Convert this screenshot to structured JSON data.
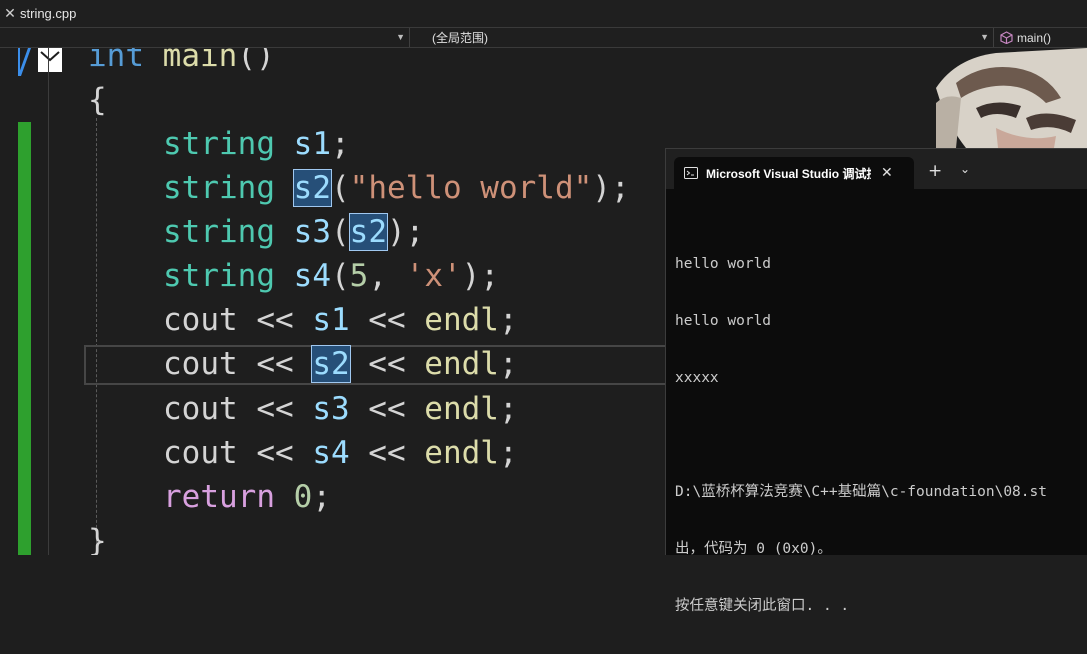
{
  "tab": {
    "close_glyph": "✕",
    "file_name": "string.cpp"
  },
  "navbar": {
    "project_combo": "",
    "scope_combo": "(全局范围)",
    "member_combo": "main()",
    "member_icon": "cube-icon"
  },
  "editor": {
    "signature": {
      "kw": "int",
      "name": "main",
      "parens": "()"
    },
    "open_brace": "{",
    "close_brace": "}",
    "lines": {
      "l1": {
        "type": "string",
        "name": "s1",
        "end": ";"
      },
      "l2": {
        "type": "string",
        "name": "s2",
        "open": "(",
        "arg": "\"hello world\"",
        "close": ");"
      },
      "l3": {
        "type": "string",
        "name": "s3",
        "open": "(",
        "arg": "s2",
        "close": ");"
      },
      "l4": {
        "type": "string",
        "name": "s4",
        "open": "(",
        "num": "5",
        "comma": ", ",
        "arg": "'x'",
        "close": ");"
      },
      "l5": {
        "a": "cout",
        "op1": " << ",
        "v": "s1",
        "op2": " << ",
        "e": "endl",
        "end": ";"
      },
      "l6": {
        "a": "cout",
        "op1": " << ",
        "v": "s2",
        "op2": " << ",
        "e": "endl",
        "end": ";"
      },
      "l7": {
        "a": "cout",
        "op1": " << ",
        "v": "s3",
        "op2": " << ",
        "e": "endl",
        "end": ";"
      },
      "l8": {
        "a": "cout",
        "op1": " << ",
        "v": "s4",
        "op2": " << ",
        "e": "endl",
        "end": ";"
      },
      "l9": {
        "kw": "return",
        "num": "0",
        "end": ";"
      }
    }
  },
  "terminal": {
    "icon": "terminal-icon",
    "title": "Microsoft Visual Studio 调试控制台",
    "close_glyph": "✕",
    "new_tab_glyph": "+",
    "dropdown_glyph": "⌄",
    "output": [
      "hello world",
      "hello world",
      "xxxxx",
      "",
      "D:\\蓝桥杯算法竞赛\\C++基础篇\\c-foundation\\08.st",
      "出，代码为 0 (0x0)。",
      "按任意键关闭此窗口. . ."
    ]
  },
  "colors": {
    "keyword": "#569cd6",
    "type": "#4ec9b0",
    "variable": "#9cdcfe",
    "string": "#ce9178",
    "function": "#dcdcaa",
    "control": "#d8a0df",
    "number": "#b5cea8",
    "change_bar": "#2ea02e"
  }
}
